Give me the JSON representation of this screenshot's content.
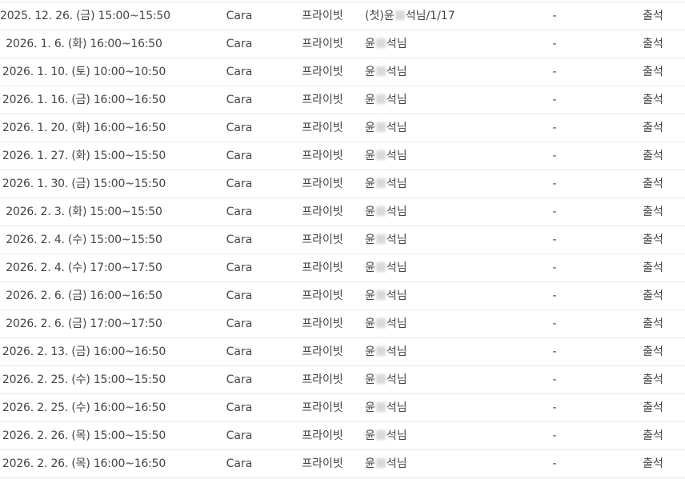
{
  "rows": [
    {
      "date": "2025. 12. 26. (금) 15:00~15:50",
      "teacher": "Cara",
      "type": "프라이빗",
      "student_pre": "(첫)윤",
      "student_post": "석님/1/17",
      "note": "-",
      "status": "출석"
    },
    {
      "date": "2026. 1. 6. (화) 16:00~16:50",
      "teacher": "Cara",
      "type": "프라이빗",
      "student_pre": "윤",
      "student_post": "석님",
      "note": "-",
      "status": "출석"
    },
    {
      "date": "2026. 1. 10. (토) 10:00~10:50",
      "teacher": "Cara",
      "type": "프라이빗",
      "student_pre": "윤",
      "student_post": "석님",
      "note": "-",
      "status": "출석"
    },
    {
      "date": "2026. 1. 16. (금) 16:00~16:50",
      "teacher": "Cara",
      "type": "프라이빗",
      "student_pre": "윤",
      "student_post": "석님",
      "note": "-",
      "status": "출석"
    },
    {
      "date": "2026. 1. 20. (화) 16:00~16:50",
      "teacher": "Cara",
      "type": "프라이빗",
      "student_pre": "윤",
      "student_post": "석님",
      "note": "-",
      "status": "출석"
    },
    {
      "date": "2026. 1. 27. (화) 15:00~15:50",
      "teacher": "Cara",
      "type": "프라이빗",
      "student_pre": "윤",
      "student_post": "석님",
      "note": "-",
      "status": "출석"
    },
    {
      "date": "2026. 1. 30. (금) 15:00~15:50",
      "teacher": "Cara",
      "type": "프라이빗",
      "student_pre": "윤",
      "student_post": "석님",
      "note": "-",
      "status": "출석"
    },
    {
      "date": "2026. 2. 3. (화) 15:00~15:50",
      "teacher": "Cara",
      "type": "프라이빗",
      "student_pre": "윤",
      "student_post": "석님",
      "note": "-",
      "status": "출석"
    },
    {
      "date": "2026. 2. 4. (수) 15:00~15:50",
      "teacher": "Cara",
      "type": "프라이빗",
      "student_pre": "윤",
      "student_post": "석님",
      "note": "-",
      "status": "출석"
    },
    {
      "date": "2026. 2. 4. (수) 17:00~17:50",
      "teacher": "Cara",
      "type": "프라이빗",
      "student_pre": "윤",
      "student_post": "석님",
      "note": "-",
      "status": "출석"
    },
    {
      "date": "2026. 2. 6. (금) 16:00~16:50",
      "teacher": "Cara",
      "type": "프라이빗",
      "student_pre": "윤",
      "student_post": "석님",
      "note": "-",
      "status": "출석"
    },
    {
      "date": "2026. 2. 6. (금) 17:00~17:50",
      "teacher": "Cara",
      "type": "프라이빗",
      "student_pre": "윤",
      "student_post": "석님",
      "note": "-",
      "status": "출석"
    },
    {
      "date": "2026. 2. 13. (금) 16:00~16:50",
      "teacher": "Cara",
      "type": "프라이빗",
      "student_pre": "윤",
      "student_post": "석님",
      "note": "-",
      "status": "출석"
    },
    {
      "date": "2026. 2. 25. (수) 15:00~15:50",
      "teacher": "Cara",
      "type": "프라이빗",
      "student_pre": "윤",
      "student_post": "석님",
      "note": "-",
      "status": "출석"
    },
    {
      "date": "2026. 2. 25. (수) 16:00~16:50",
      "teacher": "Cara",
      "type": "프라이빗",
      "student_pre": "윤",
      "student_post": "석님",
      "note": "-",
      "status": "출석"
    },
    {
      "date": "2026. 2. 26. (목) 15:00~15:50",
      "teacher": "Cara",
      "type": "프라이빗",
      "student_pre": "윤",
      "student_post": "석님",
      "note": "-",
      "status": "출석"
    },
    {
      "date": "2026. 2. 26. (목) 16:00~16:50",
      "teacher": "Cara",
      "type": "프라이빗",
      "student_pre": "윤",
      "student_post": "석님",
      "note": "-",
      "status": "출석"
    }
  ]
}
